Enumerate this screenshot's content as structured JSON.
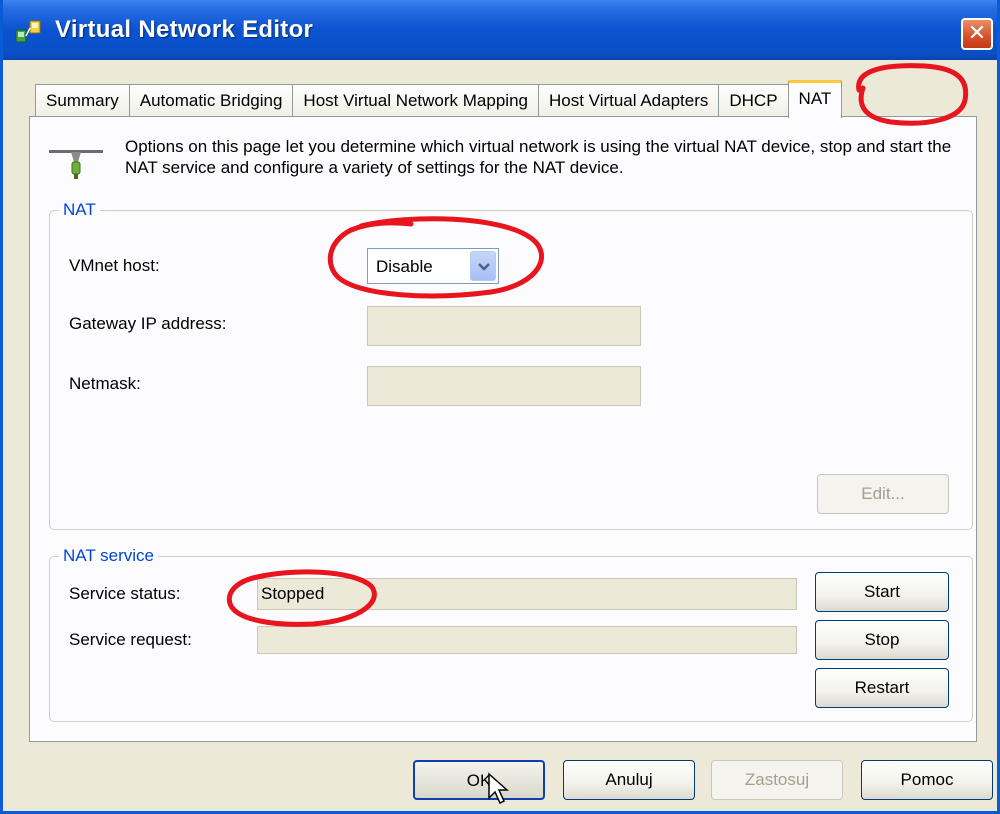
{
  "window": {
    "title": "Virtual Network Editor",
    "close_label": "✕"
  },
  "tabs": [
    {
      "label": "Summary",
      "active": false
    },
    {
      "label": "Automatic Bridging",
      "active": false
    },
    {
      "label": "Host Virtual Network Mapping",
      "active": false
    },
    {
      "label": "Host Virtual Adapters",
      "active": false
    },
    {
      "label": "DHCP",
      "active": false
    },
    {
      "label": "NAT",
      "active": true
    }
  ],
  "info": {
    "text": "Options on this page let you determine which virtual network is using the virtual NAT device, stop and start the NAT service and configure a variety of settings for the NAT device."
  },
  "nat_group": {
    "title": "NAT",
    "vmnet_host_label": "VMnet host:",
    "vmnet_host_value": "Disable",
    "gateway_label": "Gateway IP address:",
    "gateway_value": "",
    "netmask_label": "Netmask:",
    "netmask_value": "",
    "edit_label": "Edit..."
  },
  "service_group": {
    "title": "NAT service",
    "status_label": "Service status:",
    "status_value": "Stopped",
    "request_label": "Service request:",
    "request_value": "",
    "start_label": "Start",
    "stop_label": "Stop",
    "restart_label": "Restart"
  },
  "footer": {
    "ok_label": "OK",
    "cancel_label": "Anuluj",
    "apply_label": "Zastosuj",
    "help_label": "Pomoc"
  },
  "colors": {
    "titlebar": "#0a53d0",
    "group_title": "#0046d5",
    "annotation": "#e8141e",
    "active_tab_accent": "#ffc83c"
  }
}
